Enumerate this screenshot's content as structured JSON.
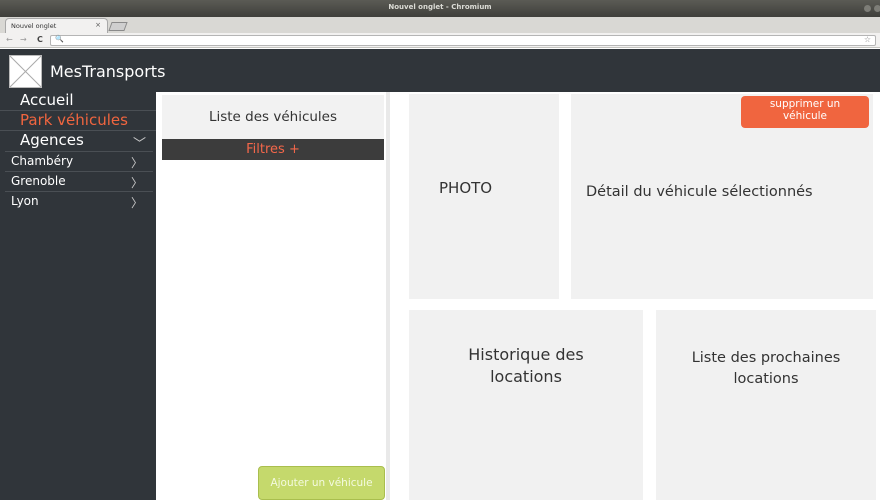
{
  "browser": {
    "window_title": "Nouvel onglet - Chromium",
    "tab_title": "Nouvel onglet",
    "tab_close": "×",
    "back": "←",
    "forward": "→",
    "reload": "C",
    "omnibox_icon": "🔍",
    "star": "☆"
  },
  "app": {
    "brand": "MesTransports",
    "logo_icon": "placeholder-image-icon"
  },
  "sidebar": {
    "items": [
      {
        "label": "Accueil",
        "active": false
      },
      {
        "label": "Park véhicules",
        "active": true
      },
      {
        "label": "Agences",
        "active": false,
        "chevron": "﹀"
      }
    ],
    "agencies": [
      {
        "label": "Chambéry",
        "chevron": "〉"
      },
      {
        "label": "Grenoble",
        "chevron": "〉"
      },
      {
        "label": "Lyon",
        "chevron": "〉"
      }
    ]
  },
  "list_panel": {
    "title": "Liste des véhicules",
    "filters": "Filtres +",
    "add_button": "Ajouter un véhicule"
  },
  "detail": {
    "photo_label": "PHOTO",
    "detail_label": "Détail du véhicule sélectionnés",
    "delete_button": "supprimer un véhicule",
    "history_label": "Historique des locations",
    "upcoming_label": "Liste des prochaines locations"
  },
  "colors": {
    "accent": "#f0653f",
    "add_button": "#c5d96c",
    "dark": "#30353a"
  }
}
